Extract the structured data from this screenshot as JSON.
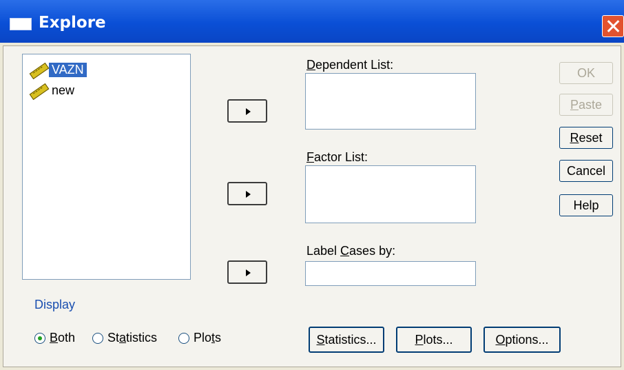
{
  "window": {
    "title": "Explore",
    "close_icon": "close-icon",
    "app_icon": "window-icon"
  },
  "variables": [
    {
      "name": "VAZN",
      "icon": "scale-variable-icon",
      "selected": true
    },
    {
      "name": "new",
      "icon": "scale-variable-icon",
      "selected": false
    }
  ],
  "fields": {
    "dependent": {
      "label_pre": "",
      "label_key": "D",
      "label_post": "ependent List:"
    },
    "factor": {
      "label_pre": "",
      "label_key": "F",
      "label_post": "actor List:"
    },
    "label_cases": {
      "label_pre": "Label ",
      "label_key": "C",
      "label_post": "ases by:"
    }
  },
  "buttons": {
    "ok": "OK",
    "paste_pre": "",
    "paste_key": "P",
    "paste_post": "aste",
    "reset_pre": "",
    "reset_key": "R",
    "reset_post": "eset",
    "cancel": "Cancel",
    "help": "Help",
    "statistics_pre": "",
    "statistics_key": "S",
    "statistics_post": "tatistics...",
    "plots_pre": "",
    "plots_key": "P",
    "plots_post": "lots...",
    "options_pre": "",
    "options_key": "O",
    "options_post": "ptions..."
  },
  "display": {
    "label": "Display",
    "both_pre": "",
    "both_key": "B",
    "both_post": "oth",
    "statistics_pre": "St",
    "statistics_key": "a",
    "statistics_post": "tistics",
    "plots_pre": "Plo",
    "plots_key": "t",
    "plots_post": "s",
    "selected": "both"
  }
}
